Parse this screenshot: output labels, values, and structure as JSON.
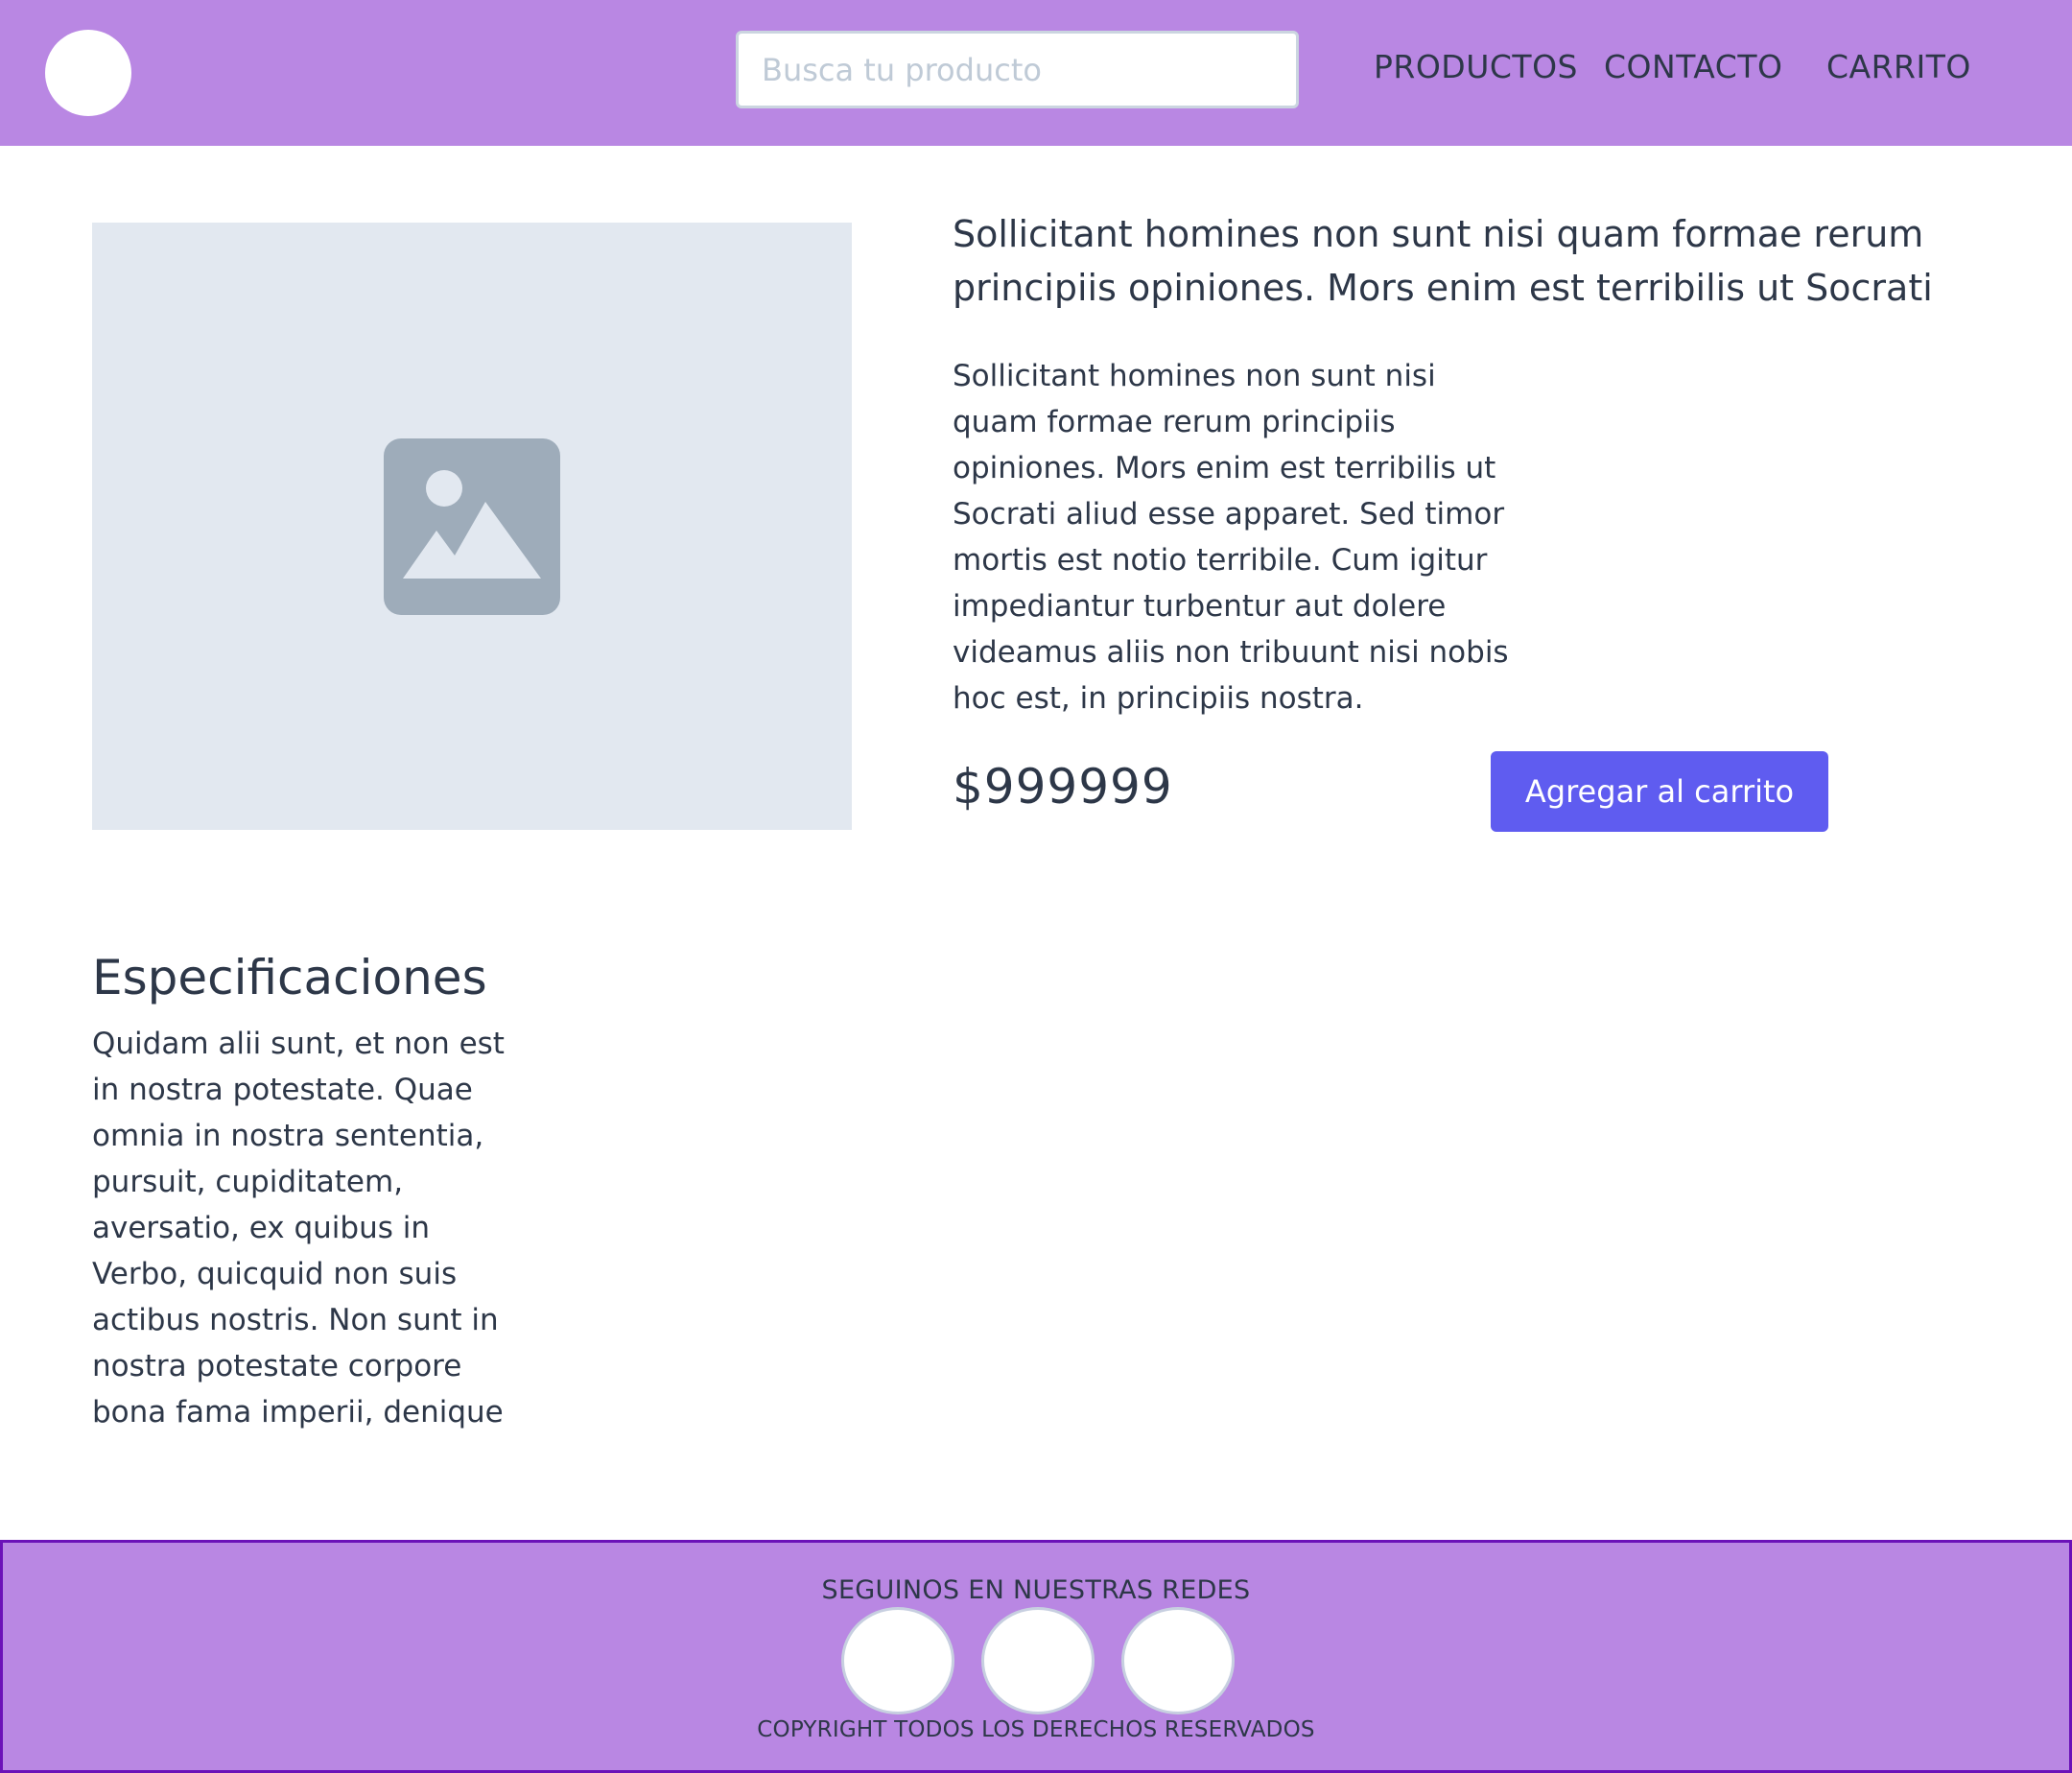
{
  "header": {
    "search": {
      "placeholder": "Busca tu producto",
      "value": ""
    },
    "nav": [
      "PRODUCTOS",
      "CONTACTO",
      "CARRITO"
    ]
  },
  "product": {
    "title": "Sollicitant homines non sunt nisi quam formae rerum principiis opiniones. Mors enim est terribilis ut Socrati",
    "description": "Sollicitant homines non sunt nisi quam formae rerum principiis opiniones. Mors enim est terribilis ut Socrati aliud esse apparet. Sed timor mortis est notio terribile. Cum igitur impediantur turbentur aut dolere videamus aliis non tribuunt nisi nobis hoc est, in principiis nostra.",
    "price": "$999999",
    "add_to_cart_label": "Agregar al carrito",
    "image_icon": "image-placeholder-icon"
  },
  "specs": {
    "title": "Especificaciones",
    "text": "Quidam alii sunt, et non est in nostra potestate. Quae omnia in nostra sententia, pursuit, cupiditatem, aversatio, ex quibus in Verbo, quicquid non suis actibus nostris. Non sunt in nostra potestate corpore bona fama imperii, denique"
  },
  "footer": {
    "follow_text": "SEGUINOS EN NUESTRAS REDES",
    "copyright": "COPYRIGHT TODOS LOS DERECHOS RESERVADOS"
  },
  "colors": {
    "header_bg": "#b987e3",
    "button_bg": "#5f5cf0",
    "image_bg": "#e2e8f0",
    "icon_fill": "#9eacba",
    "footer_border": "#6b12b8"
  }
}
